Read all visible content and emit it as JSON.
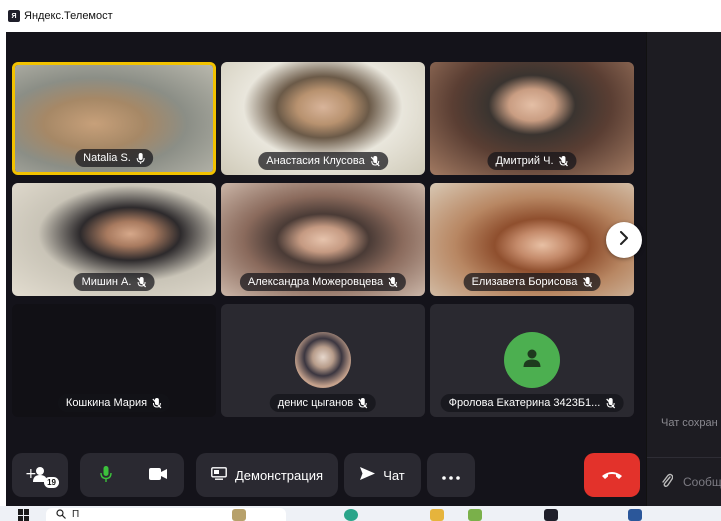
{
  "window": {
    "title": "Яндекс.Телемост",
    "icon": "telemost-logo-icon"
  },
  "participants": [
    {
      "name": "Natalia S.",
      "mic": "on",
      "active": true
    },
    {
      "name": "Анастасия Клусова",
      "mic": "off"
    },
    {
      "name": "Дмитрий Ч.",
      "mic": "off"
    },
    {
      "name": "Мишин А.",
      "mic": "off"
    },
    {
      "name": "Александра Можеровцева",
      "mic": "off"
    },
    {
      "name": "Елизавета Борисова",
      "mic": "off"
    },
    {
      "name": "Кошкина Мария",
      "mic": "off"
    },
    {
      "name": "денис цыганов",
      "mic": "off"
    },
    {
      "name": "Фролова Екатерина 3423Б1...",
      "mic": "off"
    }
  ],
  "toolbar": {
    "participants_badge": "19",
    "screen_share_label": "Демонстрация",
    "chat_label": "Чат",
    "more_icon": "more-dots-icon",
    "hangup_icon": "phone-hangup-icon"
  },
  "chat": {
    "saved_note": "Чат сохран",
    "input_placeholder": "Сообщ"
  },
  "taskbar": {
    "search_placeholder": "П"
  },
  "colors": {
    "active_border": "#f2c200",
    "hangup": "#e3322b",
    "avatar_green": "#4caf50",
    "background": "#14131a"
  }
}
